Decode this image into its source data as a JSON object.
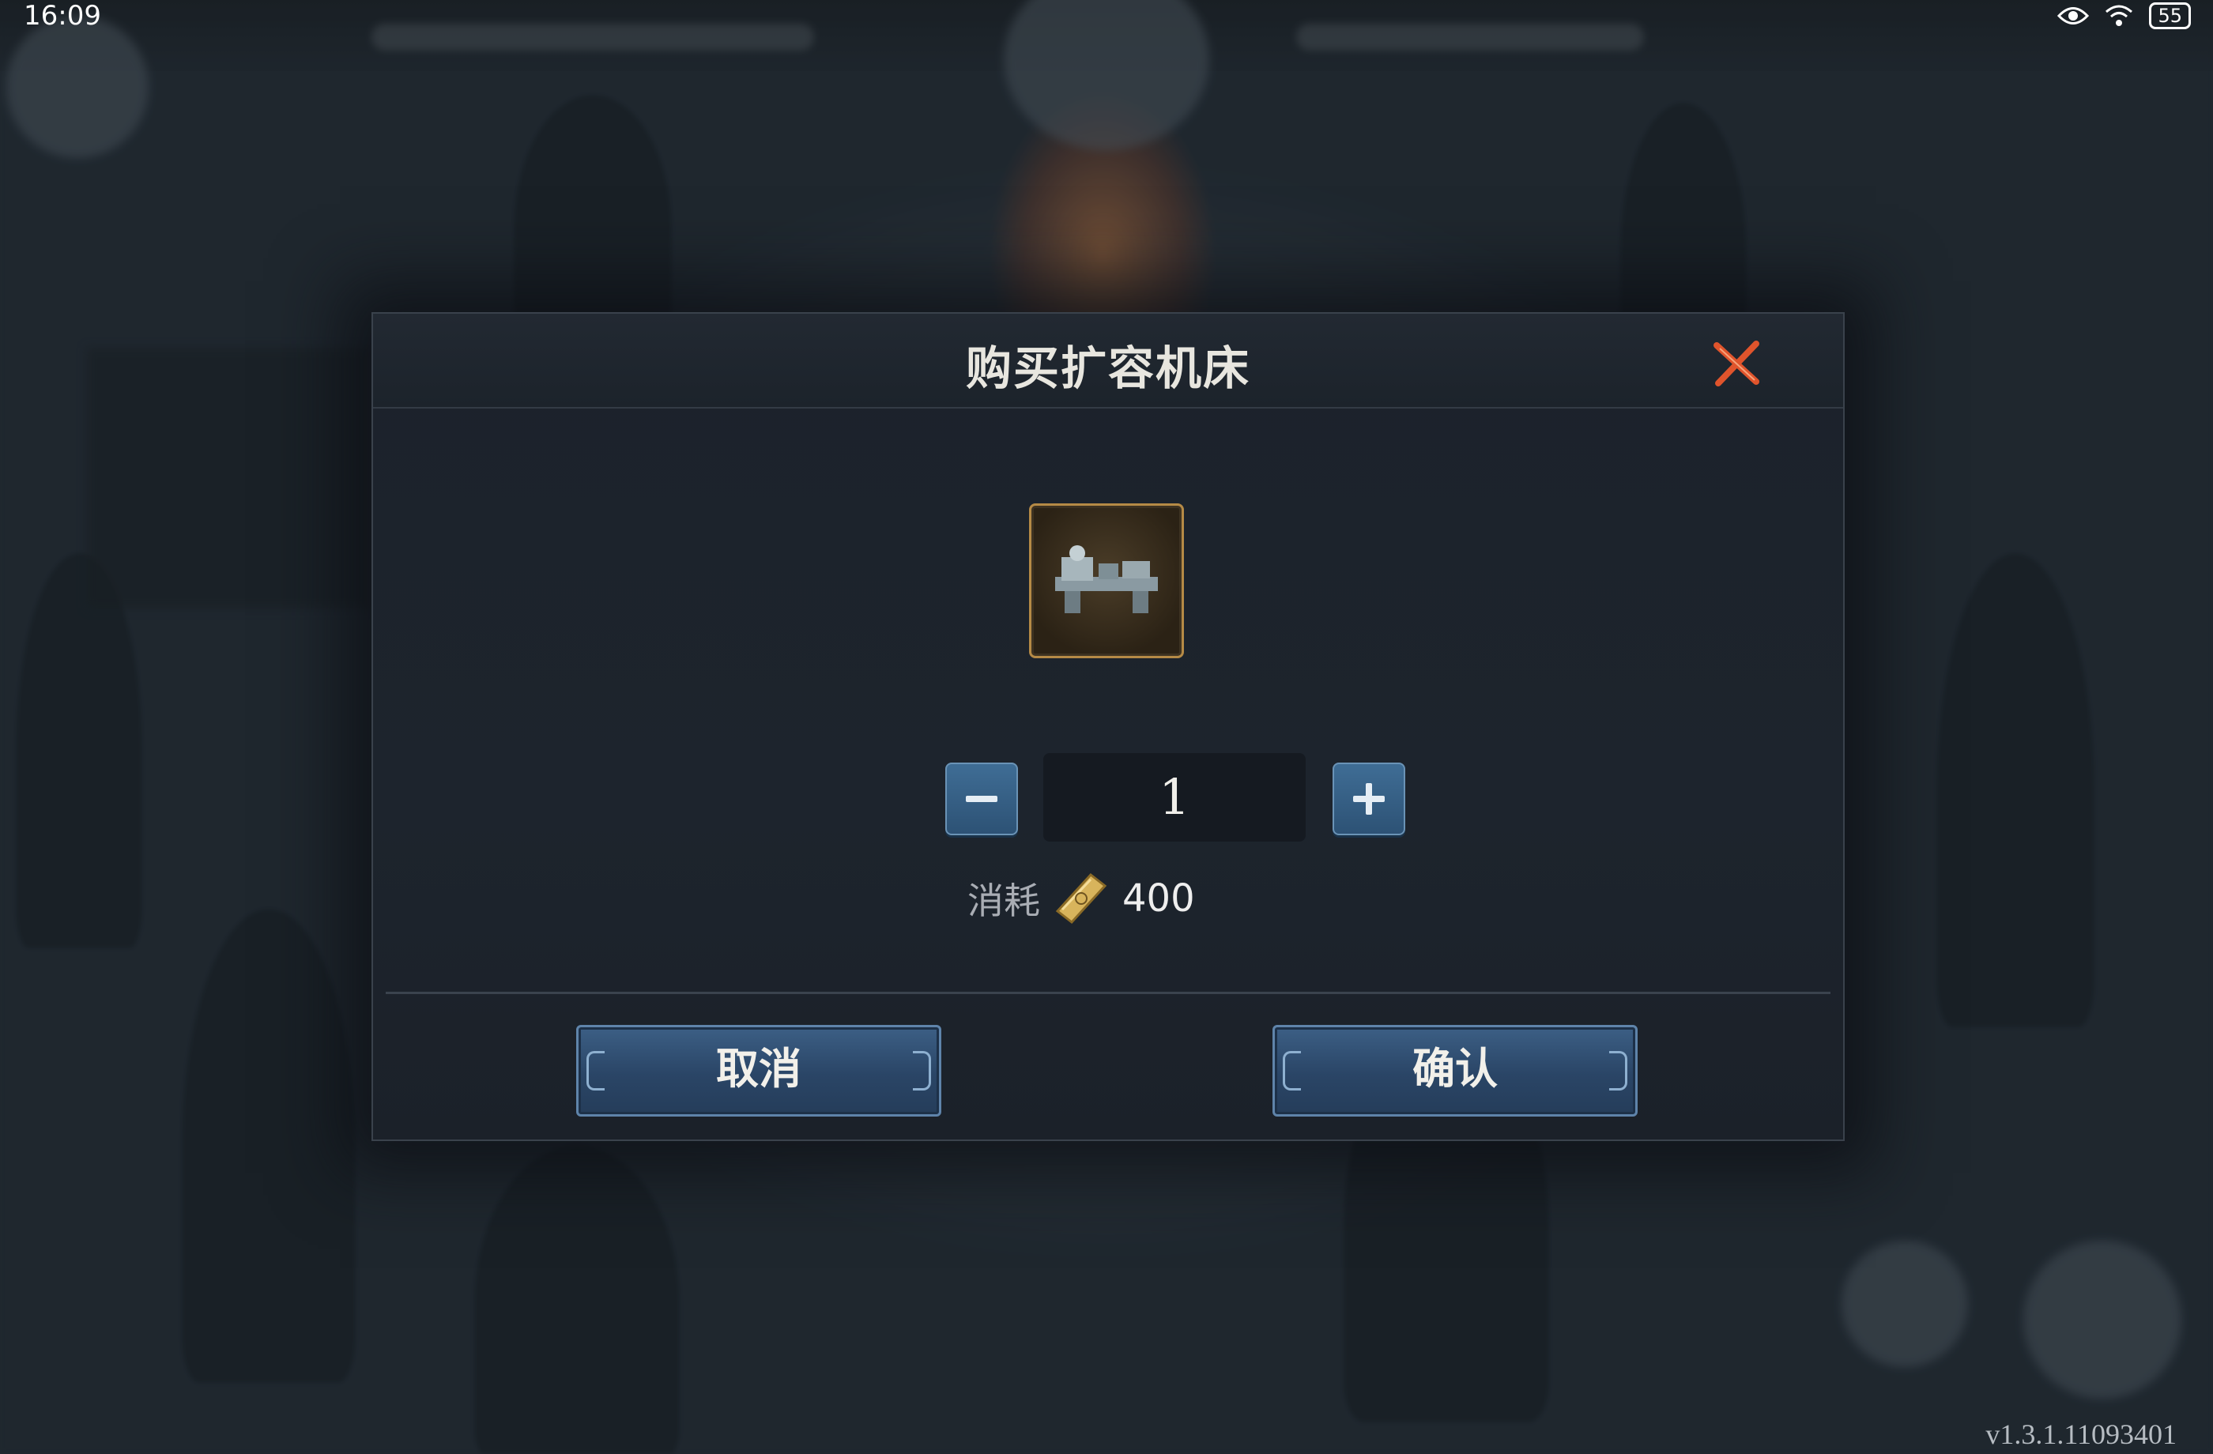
{
  "status_bar": {
    "time": "16:09",
    "battery": "55"
  },
  "dialog": {
    "title": "购买扩容机床",
    "close_icon": "close-x-icon",
    "item_icon": "lathe-machine-icon",
    "quantity": "1",
    "cost_label": "消耗",
    "cost_icon": "gold-bar-icon",
    "cost_value": "400",
    "cancel_label": "取消",
    "confirm_label": "确认"
  },
  "version": "v1.3.1.11093401",
  "colors": {
    "accent_blue": "#2d5275",
    "frame_gold": "#b58a46",
    "close_red": "#e0542c"
  }
}
